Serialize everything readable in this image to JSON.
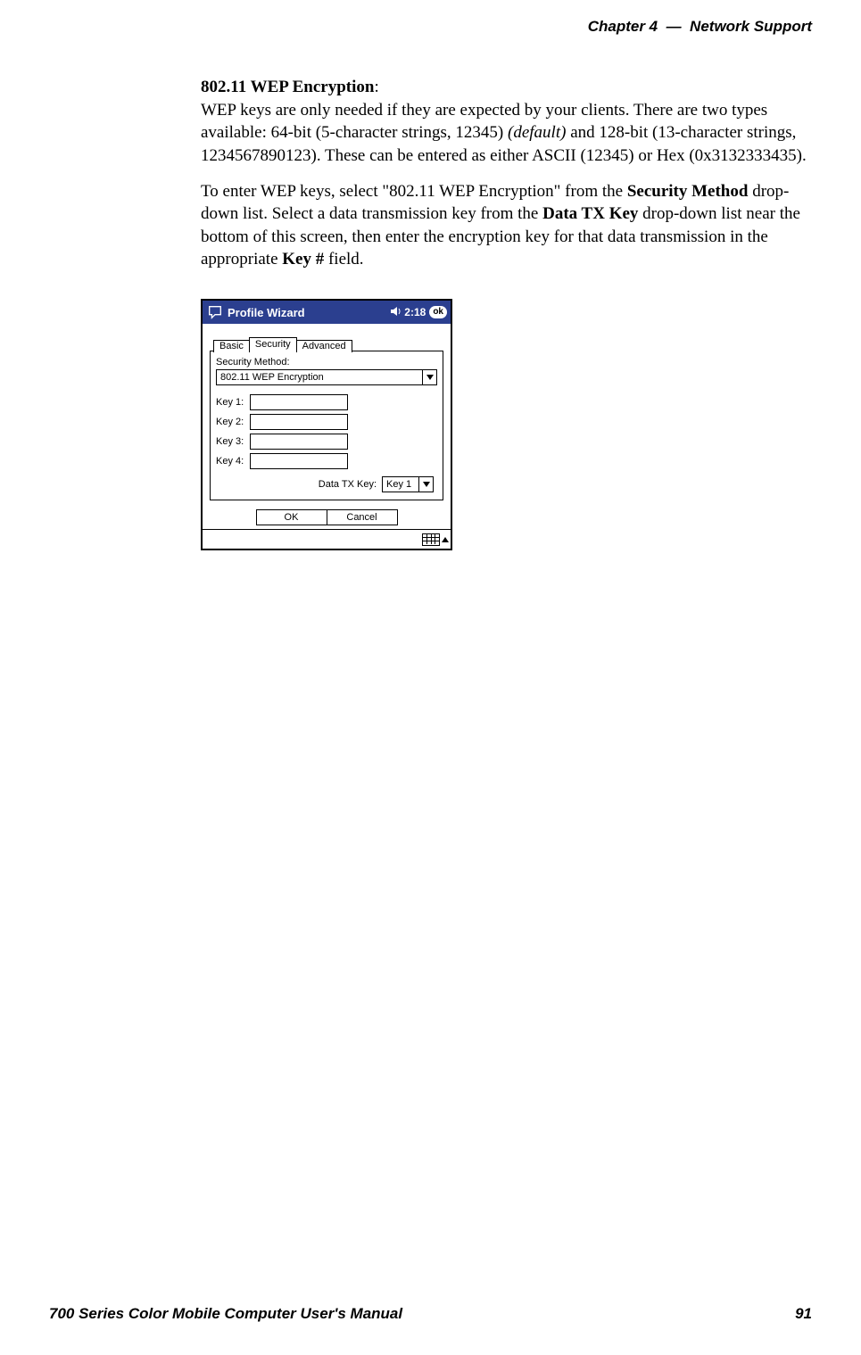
{
  "header": {
    "chapter": "Chapter  4",
    "sep": "—",
    "title": "Network Support"
  },
  "body": {
    "heading": "802.11 WEP Encryption",
    "colon": ":",
    "p1a": "WEP keys are only needed if they are expected by your clients. There are two types available: 64-bit (5-character strings, 12345) ",
    "p1i": "(default)",
    "p1b": " and 128-bit (13-character strings, 1234567890123). These can be entered as either ASCII (12345) or Hex (0x3132333435).",
    "p2a": "To enter WEP keys, select \"802.11 WEP Encryption\" from the ",
    "p2b1": "Security Method",
    "p2c": " drop-down list. Select a data transmission key from the ",
    "p2b2": "Data TX Key",
    "p2d": " drop-down list near the bottom of this screen, then enter the encryp­tion key for that data transmission in the appropriate ",
    "p2b3": "Key #",
    "p2e": " field."
  },
  "screenshot": {
    "title": "Profile Wizard",
    "time": "2:18",
    "ok": "ok",
    "tabs": {
      "basic": "Basic",
      "security": "Security",
      "advanced": "Advanced"
    },
    "securityMethodLabel": "Security Method:",
    "securityMethodValue": "802.11 WEP Encryption",
    "keys": {
      "k1": "Key 1:",
      "k2": "Key 2:",
      "k3": "Key 3:",
      "k4": "Key 4:"
    },
    "dataTxLabel": "Data TX Key:",
    "dataTxValue": "Key 1",
    "buttons": {
      "ok": "OK",
      "cancel": "Cancel"
    }
  },
  "footer": {
    "manual": "700 Series Color Mobile Computer User's Manual",
    "page": "91"
  }
}
